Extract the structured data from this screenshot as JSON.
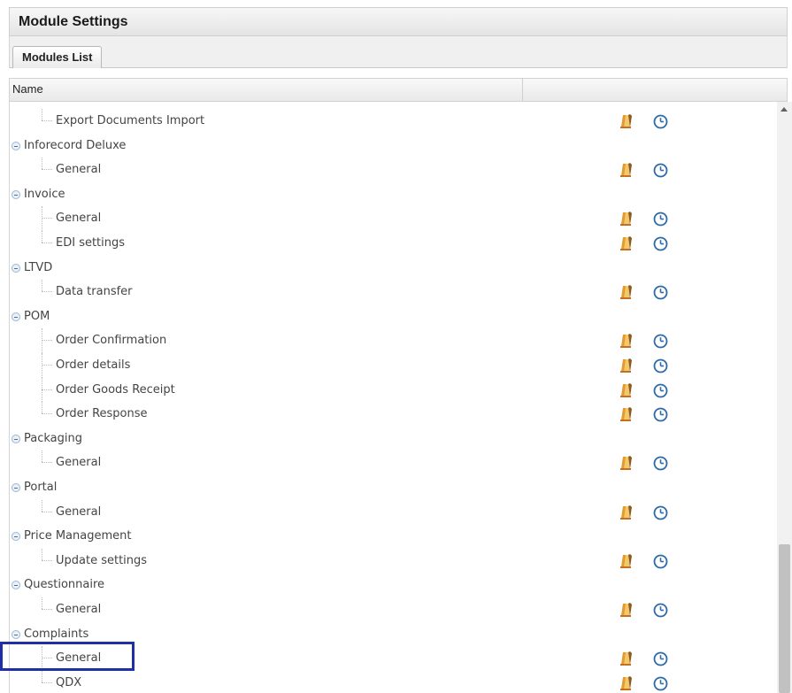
{
  "panel": {
    "title": "Module Settings"
  },
  "tabs": [
    {
      "label": "Modules List",
      "active": true
    }
  ],
  "grid": {
    "columns": [
      {
        "label": "Name"
      },
      {
        "label": ""
      }
    ],
    "icons": {
      "edit": "edit-pencil-icon",
      "schedule": "clock-icon"
    },
    "rows": [
      {
        "type": "child",
        "label": "Export Documents Import",
        "actions": true,
        "last": true
      },
      {
        "type": "parent",
        "label": "Inforecord Deluxe"
      },
      {
        "type": "child",
        "label": "General",
        "actions": true,
        "last": true
      },
      {
        "type": "parent",
        "label": "Invoice"
      },
      {
        "type": "child",
        "label": "General",
        "actions": true,
        "last": false
      },
      {
        "type": "child",
        "label": "EDI settings",
        "actions": true,
        "last": true
      },
      {
        "type": "parent",
        "label": "LTVD"
      },
      {
        "type": "child",
        "label": "Data transfer",
        "actions": true,
        "last": true
      },
      {
        "type": "parent",
        "label": "POM"
      },
      {
        "type": "child",
        "label": "Order Confirmation",
        "actions": true,
        "last": false
      },
      {
        "type": "child",
        "label": "Order details",
        "actions": true,
        "last": false
      },
      {
        "type": "child",
        "label": "Order Goods Receipt",
        "actions": true,
        "last": false
      },
      {
        "type": "child",
        "label": "Order Response",
        "actions": true,
        "last": true
      },
      {
        "type": "parent",
        "label": "Packaging"
      },
      {
        "type": "child",
        "label": "General",
        "actions": true,
        "last": true
      },
      {
        "type": "parent",
        "label": "Portal"
      },
      {
        "type": "child",
        "label": "General",
        "actions": true,
        "last": true
      },
      {
        "type": "parent",
        "label": "Price Management"
      },
      {
        "type": "child",
        "label": "Update settings",
        "actions": true,
        "last": true
      },
      {
        "type": "parent",
        "label": "Questionnaire"
      },
      {
        "type": "child",
        "label": "General",
        "actions": true,
        "last": true
      },
      {
        "type": "parent",
        "label": "Complaints",
        "highlighted": true
      },
      {
        "type": "child",
        "label": "General",
        "actions": true,
        "last": false
      },
      {
        "type": "child",
        "label": "QDX",
        "actions": true,
        "last": true
      }
    ]
  },
  "colors": {
    "highlight_border": "#1f2fa8",
    "edit_icon": "#e39b2f",
    "clock_icon": "#2e6aa8"
  }
}
